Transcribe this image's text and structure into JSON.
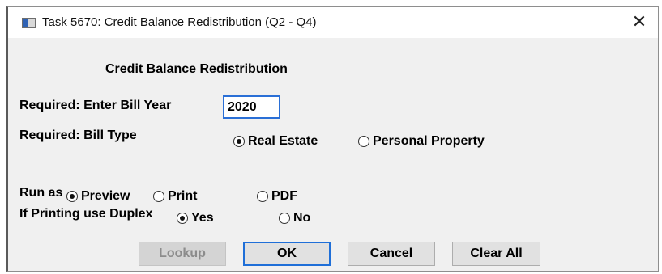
{
  "window": {
    "title": "Task 5670: Credit Balance Redistribution (Q2 - Q4)",
    "close_glyph": "✕",
    "icon": "application-window-icon"
  },
  "form": {
    "heading": "Credit Balance Redistribution",
    "bill_year": {
      "label": "Required: Enter Bill Year",
      "value": "2020"
    },
    "bill_type": {
      "label": "Required: Bill Type",
      "options": [
        "Real Estate",
        "Personal Property"
      ],
      "selected": "Real Estate"
    },
    "run_as": {
      "label": "Run as",
      "options": [
        "Preview",
        "Print",
        "PDF"
      ],
      "selected": "Preview"
    },
    "duplex": {
      "label": "If Printing use Duplex",
      "options": [
        "Yes",
        "No"
      ],
      "selected": "Yes"
    }
  },
  "buttons": {
    "lookup": "Lookup",
    "ok": "OK",
    "cancel": "Cancel",
    "clear_all": "Clear All"
  },
  "colors": {
    "focus_accent": "#2a6fd6",
    "dialog_background": "#f0f0f0"
  }
}
